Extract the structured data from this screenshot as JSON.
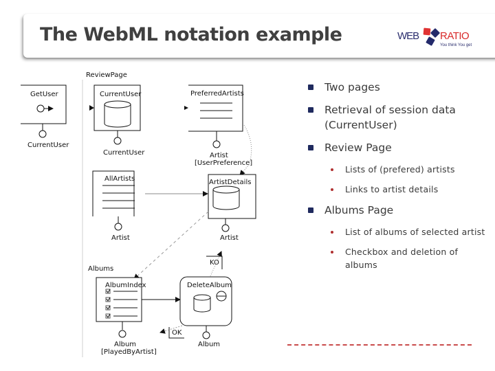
{
  "header": {
    "title": "The WebML notation example",
    "logo": {
      "left_text": "WEB",
      "right_text": "RATIO",
      "tagline": "You think You get",
      "colors": {
        "navy": "#232a6b",
        "red": "#d82a2a"
      }
    }
  },
  "diagram": {
    "pages": [
      {
        "name": "ReviewPage"
      },
      {
        "name": "Albums"
      }
    ],
    "units": {
      "get_user": {
        "name": "GetUser",
        "param": "CurrentUser"
      },
      "current_user": {
        "name": "CurrentUser",
        "param": "CurrentUser"
      },
      "preferred_artists": {
        "name": "PreferredArtists",
        "param": "Artist",
        "selector": "[UserPreference]"
      },
      "all_artists": {
        "name": "AllArtists",
        "param": "Artist"
      },
      "artist_details": {
        "name": "ArtistDetails",
        "param": "Artist"
      },
      "album_index": {
        "name": "AlbumIndex",
        "param": "Album",
        "selector": "[PlayedByArtist]"
      },
      "delete_album": {
        "name": "DeleteAlbum",
        "param": "Album"
      }
    },
    "links": {
      "ok": "OK",
      "ko": "KO"
    }
  },
  "bullets": [
    {
      "text": "Two pages",
      "children": []
    },
    {
      "text": "Retrieval of session data (CurrentUser)",
      "children": []
    },
    {
      "text": "Review Page",
      "children": [
        "Lists of (prefered) artists",
        "Links to artist details"
      ]
    },
    {
      "text": "Albums Page",
      "children": [
        "List of albums of selected artist",
        "Checkbox and deletion of albums"
      ]
    }
  ],
  "colors": {
    "bullet_primary": "#1f2a5e",
    "bullet_secondary": "#b03030",
    "footer_dash": "#c94a4a"
  }
}
